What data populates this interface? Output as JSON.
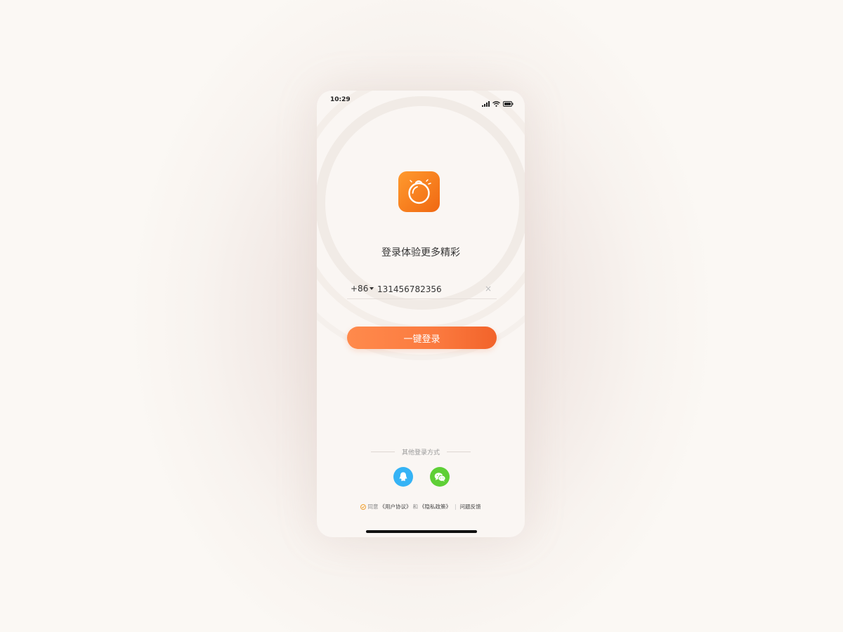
{
  "status_bar": {
    "time": "10:29",
    "icons": [
      "signal-icon",
      "wifi-icon",
      "battery-icon"
    ]
  },
  "app": {
    "icon": "orange-fruit-icon",
    "brand_color": "#f47a1f"
  },
  "login": {
    "headline": "登录体验更多精彩",
    "country_code": "+86",
    "phone_value": "131456782356",
    "clear_icon": "×",
    "button_label": "一键登录",
    "button_color": "#fb7a3f"
  },
  "other_login": {
    "label": "其他登录方式",
    "providers": [
      {
        "name": "qq-icon",
        "color": "#35b3f5"
      },
      {
        "name": "wechat-icon",
        "color": "#5ecf36"
      }
    ]
  },
  "agreement": {
    "prefix": "同意",
    "user_agreement": "《用户协议》",
    "conjunction": "和",
    "privacy_policy": "《隐私政策》",
    "separator": "|",
    "feedback": "问题反馈"
  }
}
